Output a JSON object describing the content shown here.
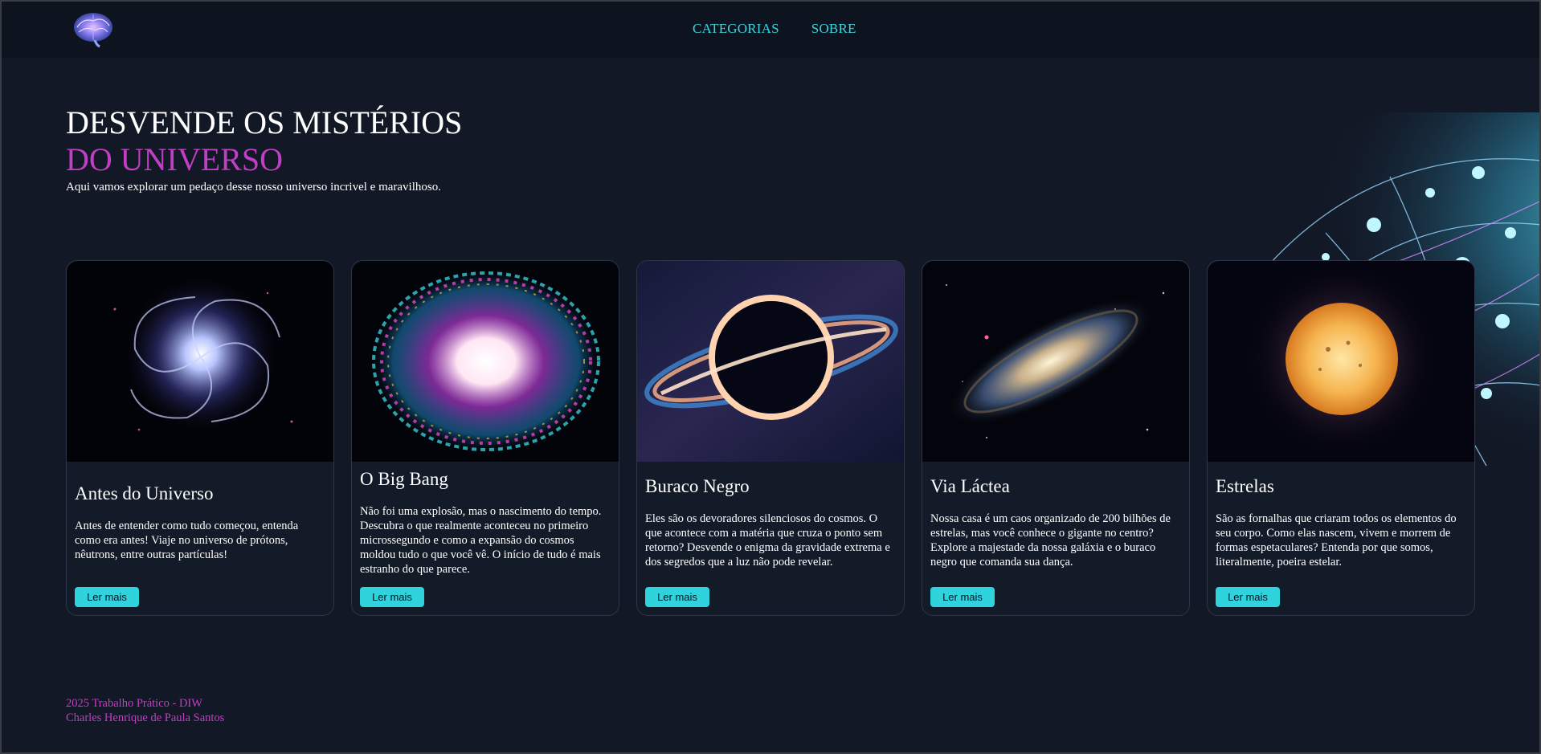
{
  "header": {
    "logo_icon": "brain-icon",
    "nav": [
      {
        "label": "CATEGORIAS"
      },
      {
        "label": "SOBRE"
      }
    ]
  },
  "hero": {
    "title_line1": "DESVENDE OS MISTÉRIOS",
    "title_line2": "DO UNIVERSO",
    "subtitle": "Aqui vamos explorar um pedaço desse nosso universo incrivel e maravilhoso.",
    "art_icon": "neural-globe-icon"
  },
  "cards": [
    {
      "image": "spiral-vortex-image",
      "title": "Antes do Universo",
      "text": "Antes de entender como tudo começou, entenda como era antes! Viaje no universo de prótons, nêutrons, entre outras partículas!",
      "button": "Ler mais"
    },
    {
      "image": "big-bang-explosion-image",
      "title": "O Big Bang",
      "text": "Não foi uma explosão, mas o nascimento do tempo. Descubra o que realmente aconteceu no primeiro microssegundo e como a expansão do cosmos moldou tudo o que você vê. O início de tudo é mais estranho do que parece.",
      "button": "Ler mais"
    },
    {
      "image": "black-hole-image",
      "title": "Buraco Negro",
      "text": "Eles são os devoradores silenciosos do cosmos. O que acontece com a matéria que cruza o ponto sem retorno? Desvende o enigma da gravidade extrema e dos segredos que a luz não pode revelar.",
      "button": "Ler mais"
    },
    {
      "image": "galaxy-image",
      "title": "Via Láctea",
      "text": "Nossa casa é um caos organizado de 200 bilhões de estrelas, mas você conhece o gigante no centro? Explore a majestade da nossa galáxia e o buraco negro que comanda sua dança.",
      "button": "Ler mais"
    },
    {
      "image": "sun-star-image",
      "title": "Estrelas",
      "text": "São as fornalhas que criaram todos os elementos do seu corpo. Como elas nascem, vivem e morrem de formas espetaculares? Entenda por que somos, literalmente, poeira estelar.",
      "button": "Ler mais"
    }
  ],
  "footer": {
    "line1": "2025 Trabalho Prático - DIW",
    "line2": "Charles Henrique de Paula Santos"
  },
  "colors": {
    "background": "#121826",
    "header": "#0e1320",
    "accent_cyan": "#2fd3dc",
    "accent_magenta": "#c13fc3"
  }
}
